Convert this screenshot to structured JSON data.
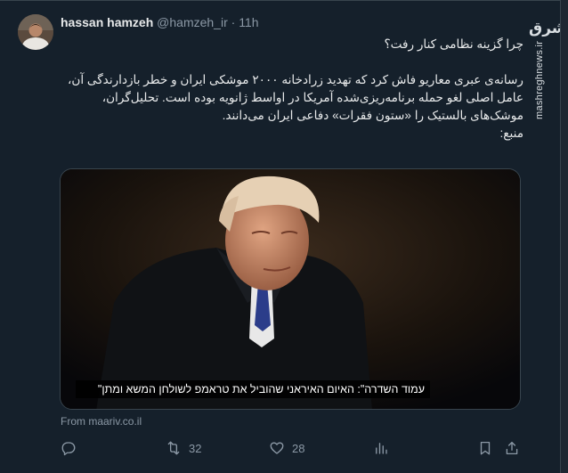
{
  "tweet": {
    "author_name": "hassan hamzeh",
    "handle": "@hamzeh_ir",
    "separator": "·",
    "time": "11h",
    "lines": [
      "چرا گزینه نظامی کنار رفت؟",
      "",
      "رسانه‌ی عبری معاریو فاش کرد که تهدید زرادخانه ۲۰۰۰ موشکی ایران و خطر بازدارندگی آن،",
      "عامل اصلی لغو حمله برنامه‌ریزی‌شده آمریکا در اواسط ژانویه بوده است. تحلیل‌گران،",
      "موشک‌های بالستیک را «ستون فقرات» دفاعی ایران می‌دانند.",
      "منبع:"
    ],
    "media_caption": "עמוד השדרה\": האיום האיראני שהוביל את טראמפ לשולחן המשא ומתן\"",
    "source_text": "From maariv.co.il"
  },
  "actions": {
    "reply_count": "",
    "retweet_count": "32",
    "like_count": "28",
    "views_count": ""
  },
  "watermark": {
    "logo_text": "مشرق",
    "site": "mashreghnews.ir"
  },
  "icons": {
    "reply": "reply-icon",
    "retweet": "retweet-icon",
    "like": "heart-icon",
    "views": "views-icon",
    "bookmark": "bookmark-icon",
    "share": "share-icon"
  }
}
